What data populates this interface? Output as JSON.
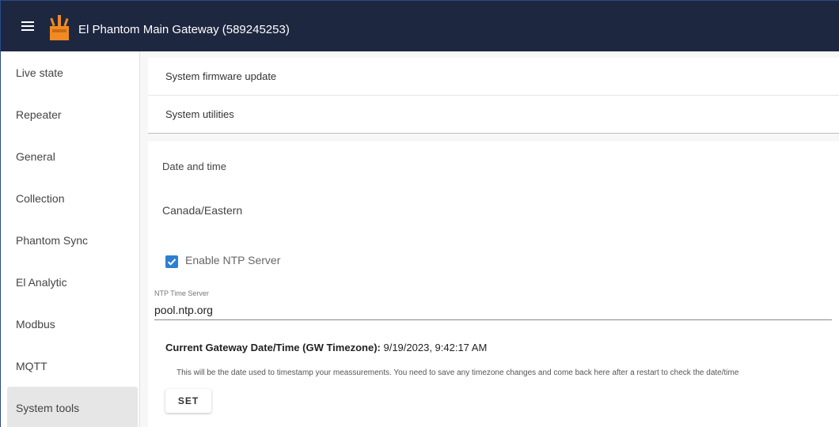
{
  "header": {
    "title": "El Phantom Main Gateway (589245253)",
    "menu_icon": "hamburger-menu-icon",
    "logo_icon": "gateway-logo-icon",
    "bg_color": "#1e2740",
    "logo_color": "#f08a24"
  },
  "sidebar": {
    "items": [
      {
        "label": "Live state"
      },
      {
        "label": "Repeater"
      },
      {
        "label": "General"
      },
      {
        "label": "Collection"
      },
      {
        "label": "Phantom Sync"
      },
      {
        "label": "El Analytic"
      },
      {
        "label": "Modbus"
      },
      {
        "label": "MQTT"
      },
      {
        "label": "System tools",
        "active": true
      }
    ]
  },
  "main": {
    "sections": [
      {
        "label": "System firmware update"
      },
      {
        "label": "System utilities"
      }
    ],
    "date_time": {
      "heading": "Date and time",
      "timezone": "Canada/Eastern",
      "ntp_enabled": true,
      "ntp_label": "Enable NTP Server",
      "ntp_server_caption": "NTP Time Server",
      "ntp_server_value": "pool.ntp.org",
      "current_label": "Current Gateway Date/Time (GW Timezone):",
      "current_value": "9/19/2023, 9:42:17 AM",
      "note": "This will be the date used to timestamp your meassurements. You need to save any timezone changes and come back here after a restart to check the date/time",
      "set_button": "SET",
      "accent_color": "#2d7fd3"
    }
  }
}
